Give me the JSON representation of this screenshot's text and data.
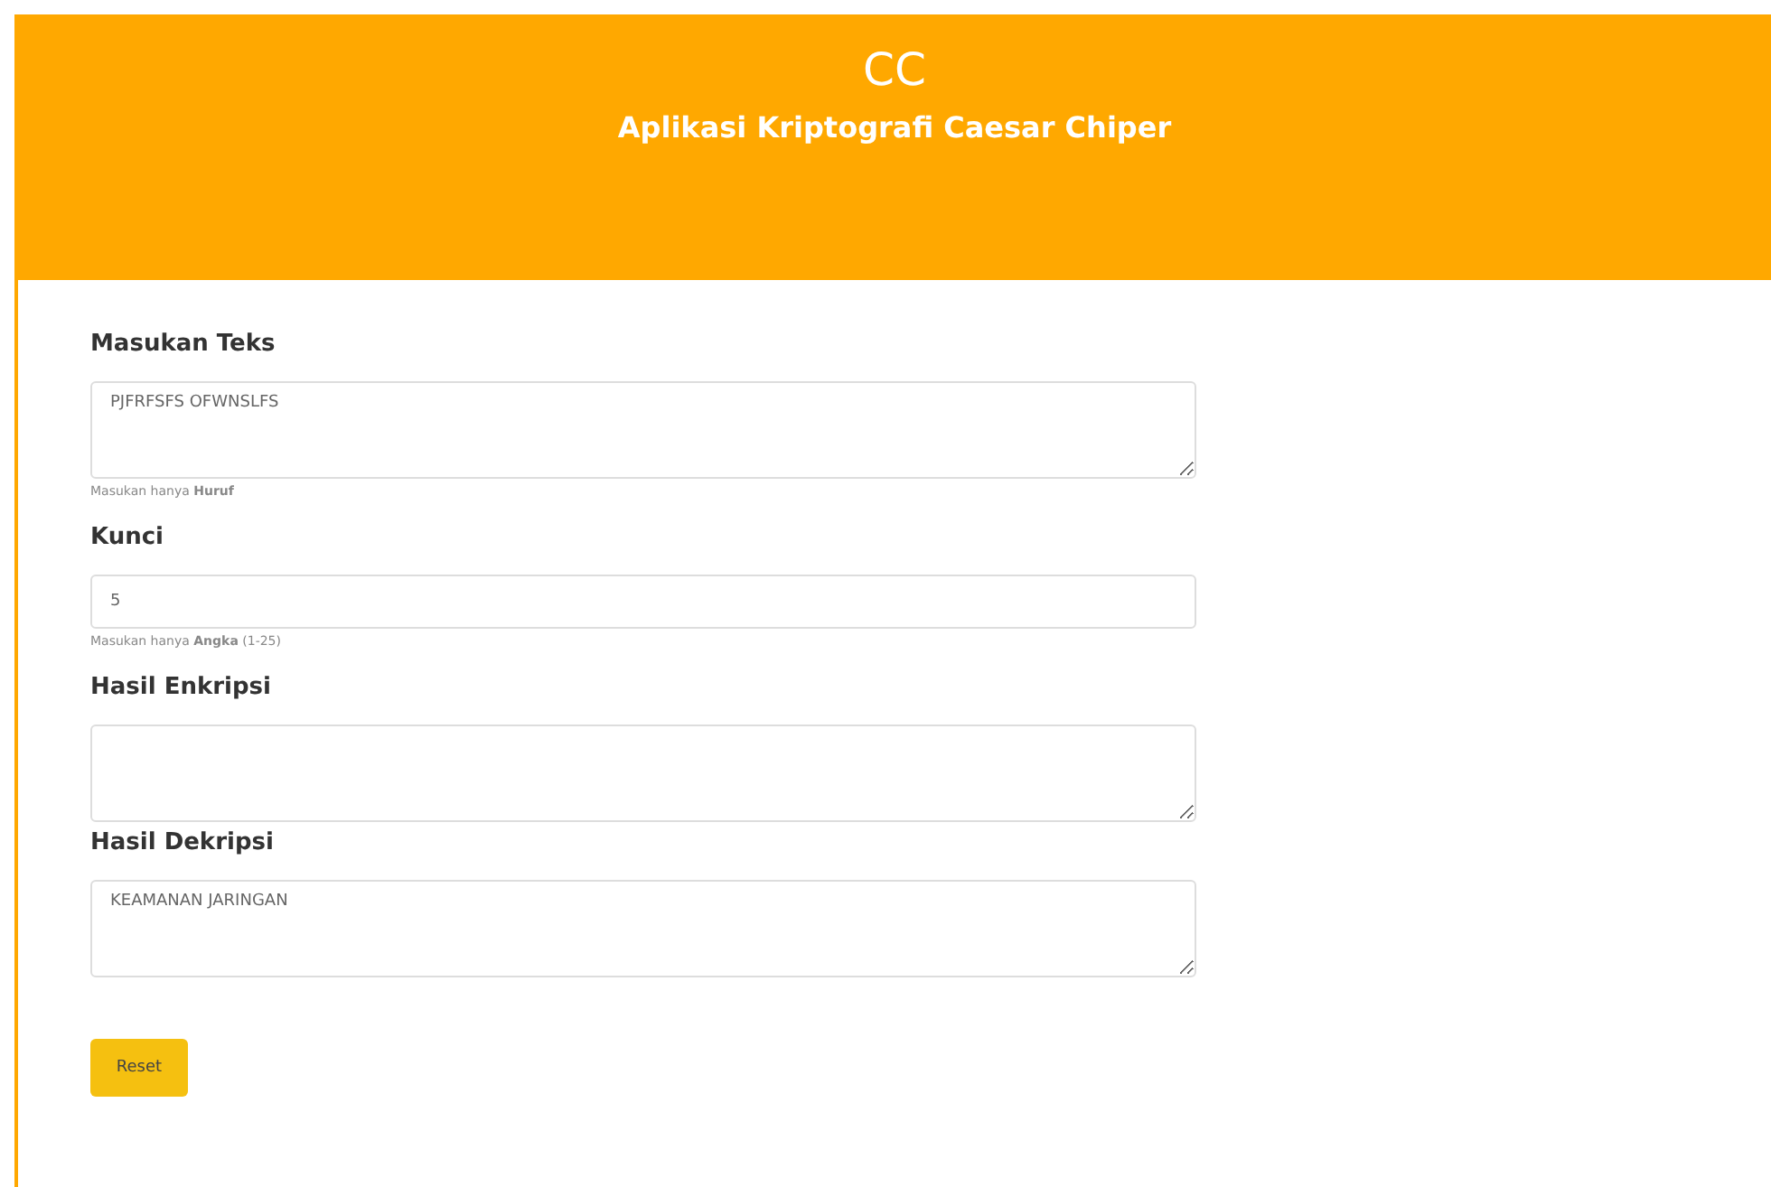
{
  "header": {
    "title": "CC",
    "subtitle": "Aplikasi Kriptografi Caesar Chiper"
  },
  "fields": [
    {
      "label": "Masukan Teks",
      "kind": "textarea",
      "value": "PJFRFSFS OFWNSLFS",
      "hint": "Masukan hanya **Huruf**"
    },
    {
      "label": "Kunci",
      "kind": "input",
      "value": "5",
      "hint": "Masukan hanya **Angka** (1-25)"
    },
    {
      "label": "Hasil Enkripsi",
      "kind": "textarea"
    },
    {
      "label": "Hasil Dekripsi",
      "kind": "textarea",
      "value": "KEAMANAN JARINGAN"
    }
  ],
  "button": "Reset"
}
